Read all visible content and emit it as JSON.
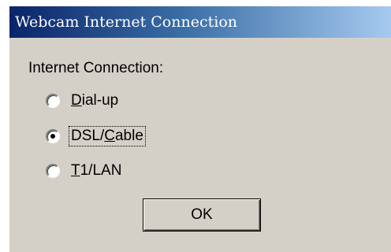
{
  "window": {
    "title": "Webcam Internet Connection"
  },
  "group": {
    "label": "Internet Connection:"
  },
  "options": [
    {
      "pre": "",
      "accel": "D",
      "post": "ial-up",
      "selected": false
    },
    {
      "pre": "DSL/",
      "accel": "C",
      "post": "able",
      "selected": true
    },
    {
      "pre": "",
      "accel": "T",
      "post": "1/LAN",
      "selected": false
    }
  ],
  "buttons": {
    "ok_label": "OK"
  },
  "colors": {
    "titlebar_start": "#0a246a",
    "titlebar_end": "#a6caf0",
    "dialog_face": "#d4d0c8"
  }
}
